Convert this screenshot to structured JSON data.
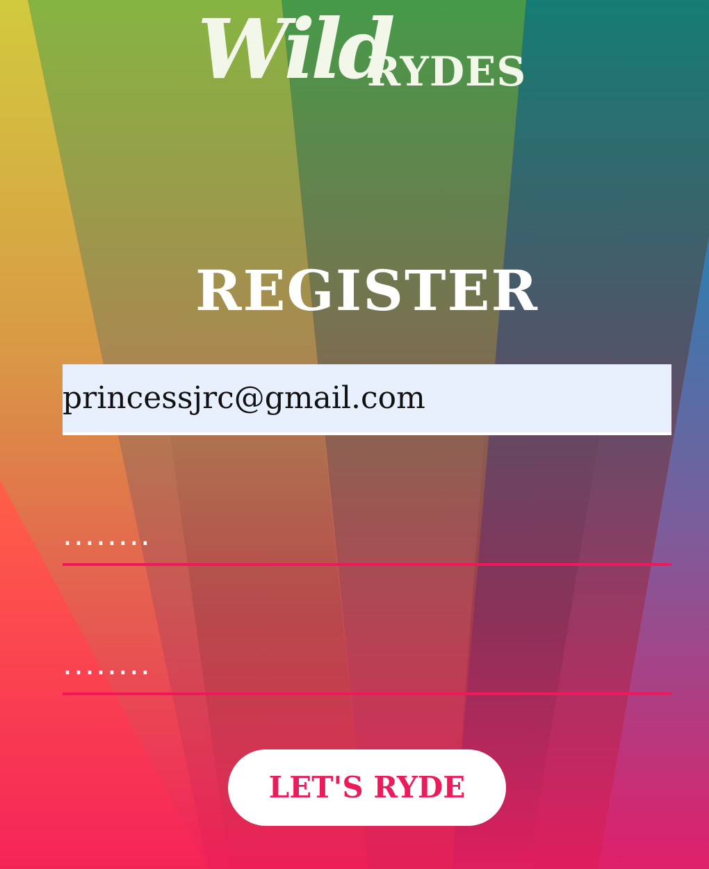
{
  "brand": {
    "logo_word_script": "Wild",
    "logo_word_caps": "RYDES"
  },
  "page": {
    "title": "REGISTER"
  },
  "form": {
    "email_value": "princessjrc@gmail.com",
    "password_value": "........",
    "confirm_password_value": "........",
    "submit_label": "LET'S RYDE"
  },
  "colors": {
    "accent": "#eb1b5c",
    "input_autofill_bg": "#e8f0fe",
    "text_light": "#ffffff"
  }
}
